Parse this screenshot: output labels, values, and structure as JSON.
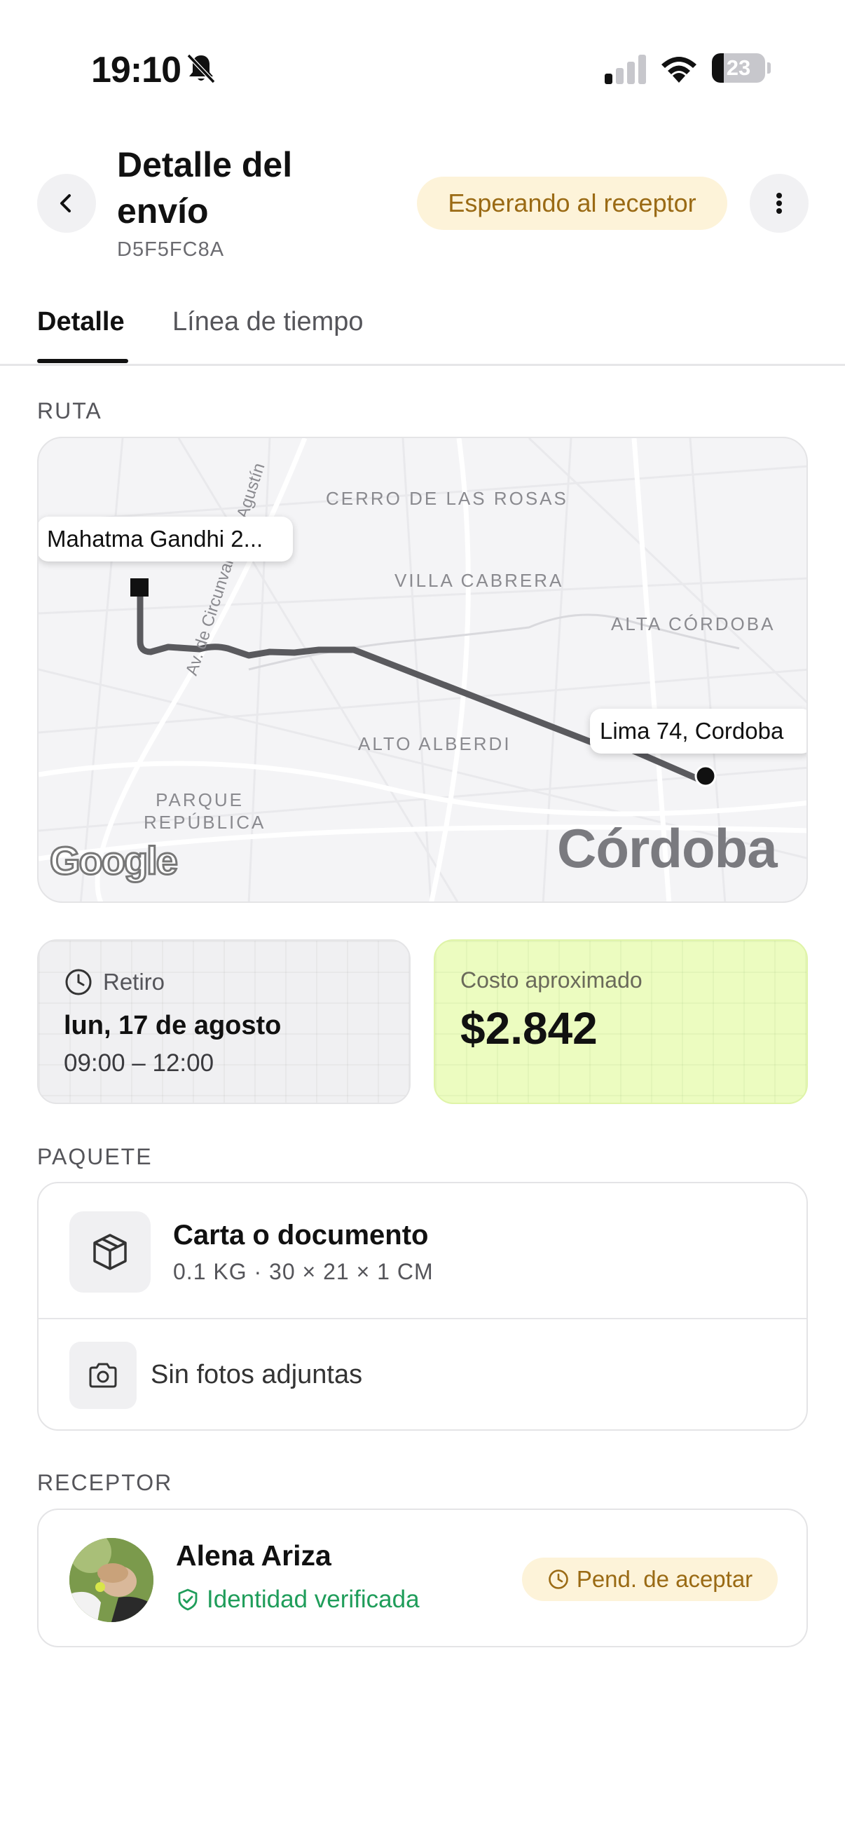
{
  "status_bar": {
    "time": "19:10",
    "battery_percent": 23,
    "battery_label": "23",
    "icons": [
      "bell-slash-icon",
      "cellular-signal-icon",
      "wifi-icon",
      "battery-icon"
    ]
  },
  "header": {
    "title": "Detalle del envío",
    "shipment_id": "D5F5FC8A",
    "status": "Esperando al receptor",
    "status_color": "#9a6a14",
    "status_bg": "#fdf3d9"
  },
  "tabs": [
    {
      "label": "Detalle",
      "active": true
    },
    {
      "label": "Línea de tiempo",
      "active": false
    }
  ],
  "route": {
    "section_label": "RUTA",
    "origin_label": "Mahatma Gandhi 2...",
    "destination_label": "Lima 74, Cordoba",
    "map": {
      "city": "Córdoba",
      "areas": [
        "CERRO DE LAS ROSAS",
        "VILLA CABRERA",
        "ALTA CÓRDOBA",
        "ALTO ALBERDI",
        "PARQUE REPÚBLICA"
      ],
      "street": "Av. de Circunvalación Agustín",
      "attribution": "Google"
    }
  },
  "pickup": {
    "label": "Retiro",
    "date": "lun, 17 de agosto",
    "time_range": "09:00 – 12:00"
  },
  "cost": {
    "label": "Costo aproximado",
    "value": "$2.842",
    "bg_color": "#ecfcc0"
  },
  "package": {
    "section_label": "PAQUETE",
    "name": "Carta o documento",
    "dimensions": "0.1 KG · 30 × 21 × 1 CM",
    "photos_label": "Sin fotos adjuntas"
  },
  "receiver": {
    "section_label": "RECEPTOR",
    "name": "Alena Ariza",
    "verification": "Identidad verificada",
    "verification_color": "#1f9d5a",
    "status": "Pend. de aceptar"
  }
}
